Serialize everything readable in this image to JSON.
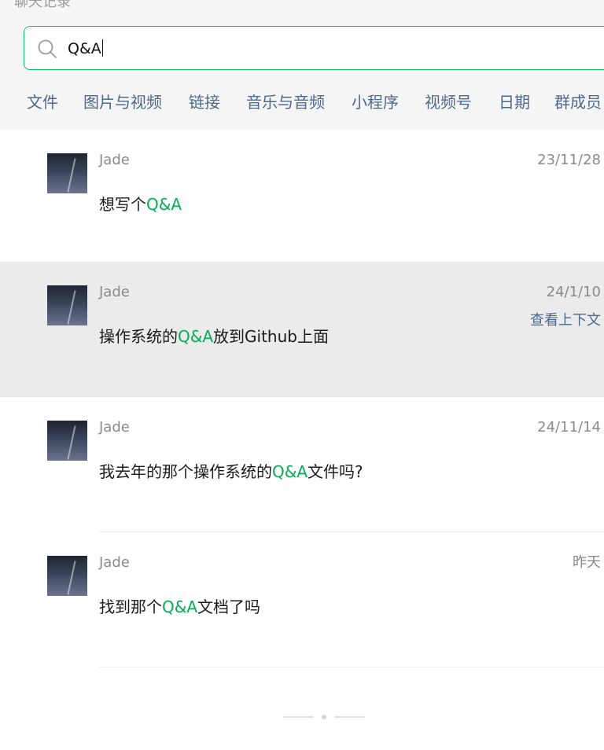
{
  "header": {
    "cut_text": "聊天记录"
  },
  "search": {
    "value": "Q&A"
  },
  "filters": [
    "文件",
    "图片与视频",
    "链接",
    "音乐与音频",
    "小程序",
    "视频号",
    "日期",
    "群成员"
  ],
  "results": [
    {
      "name": "Jade",
      "date": "23/11/28",
      "text_before": "想写个",
      "highlight": "Q&A",
      "text_after": "",
      "context_link": ""
    },
    {
      "name": "Jade",
      "date": "24/1/10",
      "text_before": "操作系统的",
      "highlight": "Q&A",
      "text_after": "放到Github上面",
      "context_link": "查看上下文"
    },
    {
      "name": "Jade",
      "date": "24/11/14",
      "text_before": "我去年的那个操作系统的",
      "highlight": "Q&A",
      "text_after": "文件吗?",
      "context_link": ""
    },
    {
      "name": "Jade",
      "date": "昨天",
      "text_before": "找到那个",
      "highlight": "Q&A",
      "text_after": "文档了吗",
      "context_link": ""
    }
  ],
  "colors": {
    "accent": "#07c160",
    "highlight": "#06ad56",
    "link": "#4b6a8f",
    "active_row": "#ebebeb"
  }
}
